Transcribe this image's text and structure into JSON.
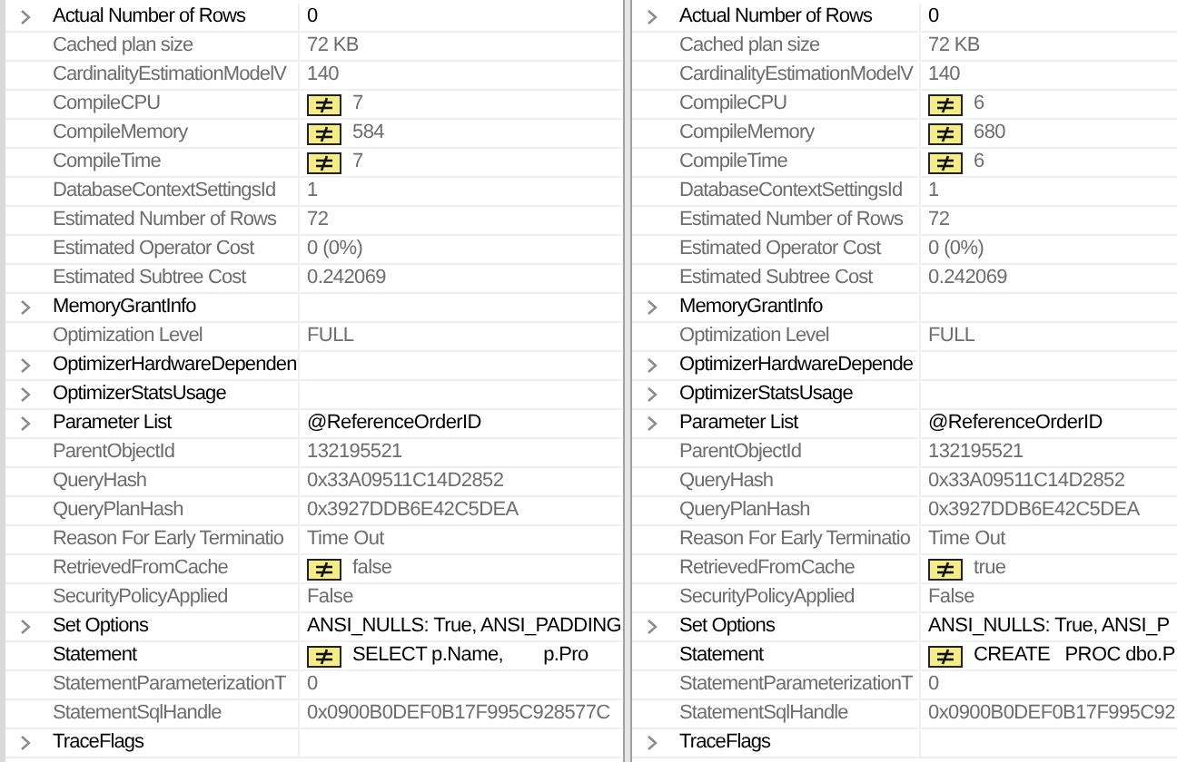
{
  "panes": [
    {
      "rows": [
        {
          "name": "Actual Number of Rows",
          "value": "0",
          "expandable": true,
          "readonly": false,
          "differs": false
        },
        {
          "name": "Cached plan size",
          "value": "72 KB",
          "expandable": false,
          "readonly": true,
          "differs": false
        },
        {
          "name": "CardinalityEstimationModelV",
          "value": "140",
          "expandable": false,
          "readonly": true,
          "differs": false
        },
        {
          "name": "CompileCPU",
          "value": "7",
          "expandable": false,
          "readonly": true,
          "differs": true
        },
        {
          "name": "CompileMemory",
          "value": "584",
          "expandable": false,
          "readonly": true,
          "differs": true
        },
        {
          "name": "CompileTime",
          "value": "7",
          "expandable": false,
          "readonly": true,
          "differs": true
        },
        {
          "name": "DatabaseContextSettingsId",
          "value": "1",
          "expandable": false,
          "readonly": true,
          "differs": false
        },
        {
          "name": "Estimated Number of Rows",
          "value": "72",
          "expandable": false,
          "readonly": true,
          "differs": false
        },
        {
          "name": "Estimated Operator Cost",
          "value": "0 (0%)",
          "expandable": false,
          "readonly": true,
          "differs": false
        },
        {
          "name": "Estimated Subtree Cost",
          "value": "0.242069",
          "expandable": false,
          "readonly": true,
          "differs": false
        },
        {
          "name": "MemoryGrantInfo",
          "expandable": true,
          "readonly": false,
          "differs": false
        },
        {
          "name": "Optimization Level",
          "value": "FULL",
          "expandable": false,
          "readonly": true,
          "differs": false
        },
        {
          "name": "OptimizerHardwareDependen",
          "expandable": true,
          "readonly": false,
          "differs": false
        },
        {
          "name": "OptimizerStatsUsage",
          "expandable": true,
          "readonly": false,
          "differs": false
        },
        {
          "name": "Parameter List",
          "value": "@ReferenceOrderID",
          "expandable": true,
          "readonly": false,
          "differs": false
        },
        {
          "name": "ParentObjectId",
          "value": "132195521",
          "expandable": false,
          "readonly": true,
          "differs": false
        },
        {
          "name": "QueryHash",
          "value": "0x33A09511C14D2852",
          "expandable": false,
          "readonly": true,
          "differs": false
        },
        {
          "name": "QueryPlanHash",
          "value": "0x3927DDB6E42C5DEA",
          "expandable": false,
          "readonly": true,
          "differs": false
        },
        {
          "name": "Reason For Early Terminatio",
          "value": "Time Out",
          "expandable": false,
          "readonly": true,
          "differs": false
        },
        {
          "name": "RetrievedFromCache",
          "value": "false",
          "expandable": false,
          "readonly": true,
          "differs": true
        },
        {
          "name": "SecurityPolicyApplied",
          "value": "False",
          "expandable": false,
          "readonly": true,
          "differs": false
        },
        {
          "name": "Set Options",
          "value": "ANSI_NULLS: True, ANSI_PADDING",
          "expandable": true,
          "readonly": false,
          "differs": false
        },
        {
          "name": "Statement",
          "value": "SELECT p.Name,        p.Pro",
          "expandable": false,
          "readonly": false,
          "differs": true
        },
        {
          "name": "StatementParameterizationT",
          "value": "0",
          "expandable": false,
          "readonly": true,
          "differs": false
        },
        {
          "name": "StatementSqlHandle",
          "value": "0x0900B0DEF0B17F995C928577C",
          "expandable": false,
          "readonly": true,
          "differs": false
        },
        {
          "name": "TraceFlags",
          "expandable": true,
          "readonly": false,
          "differs": false
        }
      ]
    },
    {
      "rows": [
        {
          "name": "Actual Number of Rows",
          "value": "0",
          "expandable": true,
          "readonly": false,
          "differs": false
        },
        {
          "name": "Cached plan size",
          "value": "72 KB",
          "expandable": false,
          "readonly": true,
          "differs": false
        },
        {
          "name": "CardinalityEstimationModelV",
          "value": "140",
          "expandable": false,
          "readonly": true,
          "differs": false
        },
        {
          "name": "CompileCPU",
          "value": "6",
          "expandable": false,
          "readonly": true,
          "differs": true
        },
        {
          "name": "CompileMemory",
          "value": "680",
          "expandable": false,
          "readonly": true,
          "differs": true
        },
        {
          "name": "CompileTime",
          "value": "6",
          "expandable": false,
          "readonly": true,
          "differs": true
        },
        {
          "name": "DatabaseContextSettingsId",
          "value": "1",
          "expandable": false,
          "readonly": true,
          "differs": false
        },
        {
          "name": "Estimated Number of Rows",
          "value": "72",
          "expandable": false,
          "readonly": true,
          "differs": false
        },
        {
          "name": "Estimated Operator Cost",
          "value": "0 (0%)",
          "expandable": false,
          "readonly": true,
          "differs": false
        },
        {
          "name": "Estimated Subtree Cost",
          "value": "0.242069",
          "expandable": false,
          "readonly": true,
          "differs": false
        },
        {
          "name": "MemoryGrantInfo",
          "expandable": true,
          "readonly": false,
          "differs": false
        },
        {
          "name": "Optimization Level",
          "value": "FULL",
          "expandable": false,
          "readonly": true,
          "differs": false
        },
        {
          "name": "OptimizerHardwareDepende",
          "expandable": true,
          "readonly": false,
          "differs": false
        },
        {
          "name": "OptimizerStatsUsage",
          "expandable": true,
          "readonly": false,
          "differs": false
        },
        {
          "name": "Parameter List",
          "value": "@ReferenceOrderID",
          "expandable": true,
          "readonly": false,
          "differs": false
        },
        {
          "name": "ParentObjectId",
          "value": "132195521",
          "expandable": false,
          "readonly": true,
          "differs": false
        },
        {
          "name": "QueryHash",
          "value": "0x33A09511C14D2852",
          "expandable": false,
          "readonly": true,
          "differs": false
        },
        {
          "name": "QueryPlanHash",
          "value": "0x3927DDB6E42C5DEA",
          "expandable": false,
          "readonly": true,
          "differs": false
        },
        {
          "name": "Reason For Early Terminatio",
          "value": "Time Out",
          "expandable": false,
          "readonly": true,
          "differs": false
        },
        {
          "name": "RetrievedFromCache",
          "value": "true",
          "expandable": false,
          "readonly": true,
          "differs": true
        },
        {
          "name": "SecurityPolicyApplied",
          "value": "False",
          "expandable": false,
          "readonly": true,
          "differs": false
        },
        {
          "name": "Set Options",
          "value": "ANSI_NULLS: True, ANSI_P",
          "expandable": true,
          "readonly": false,
          "differs": false
        },
        {
          "name": "Statement",
          "value": "CREATE   PROC dbo.P",
          "expandable": false,
          "readonly": false,
          "differs": true
        },
        {
          "name": "StatementParameterizationT",
          "value": "0",
          "expandable": false,
          "readonly": true,
          "differs": false
        },
        {
          "name": "StatementSqlHandle",
          "value": "0x0900B0DEF0B17F995C92",
          "expandable": false,
          "readonly": true,
          "differs": false
        },
        {
          "name": "TraceFlags",
          "expandable": true,
          "readonly": false,
          "differs": false
        }
      ]
    }
  ]
}
